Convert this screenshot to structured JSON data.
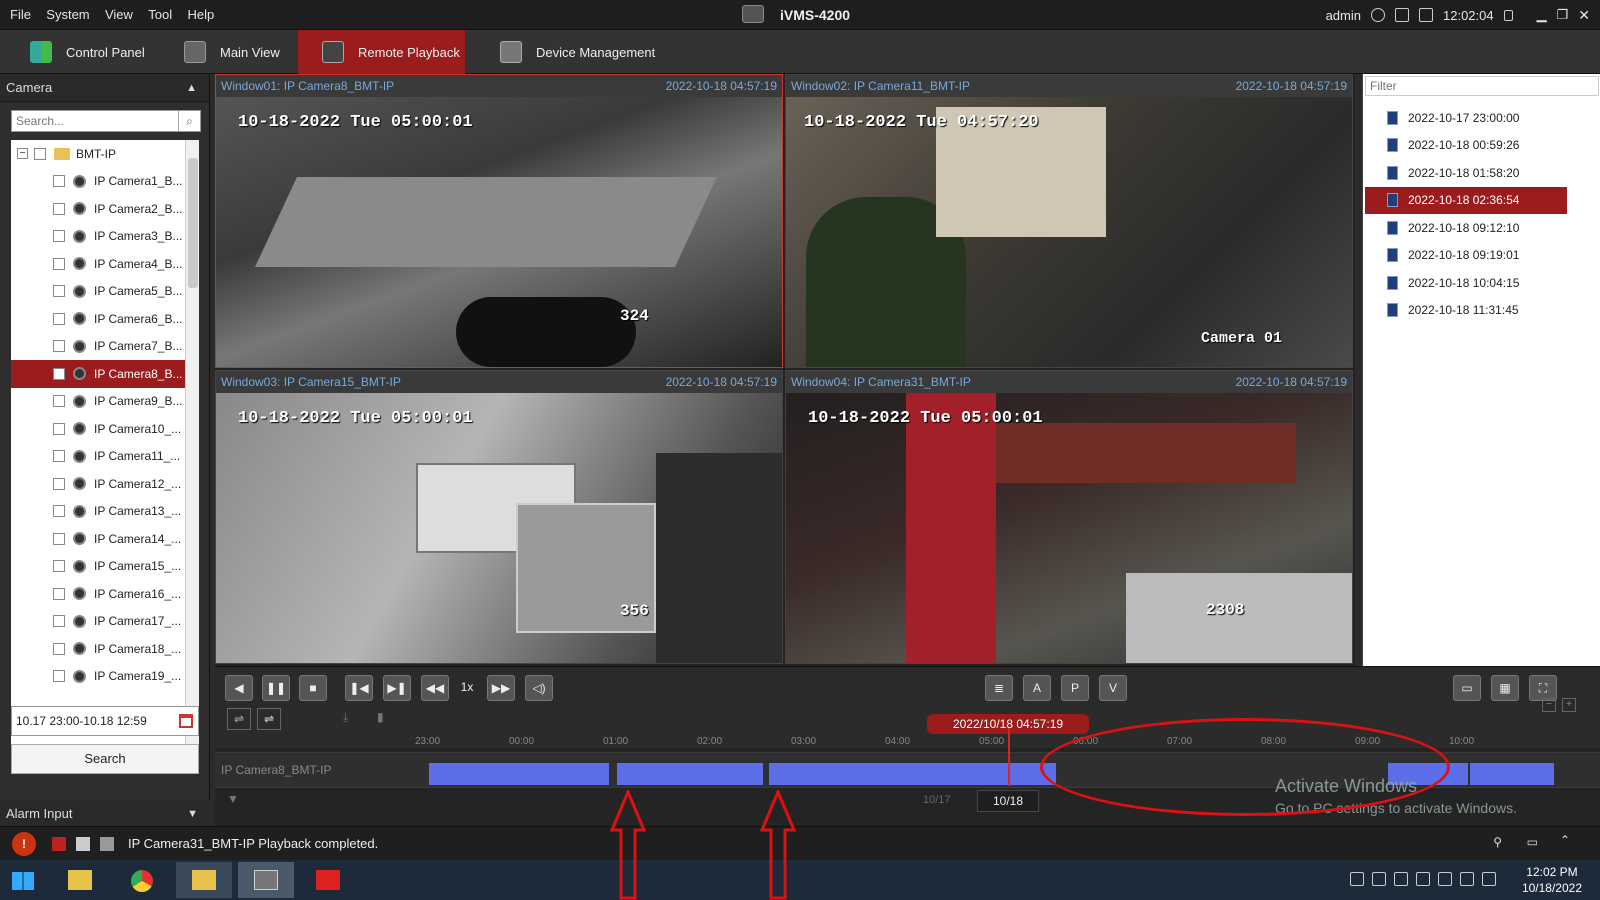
{
  "menubar": {
    "items": [
      "File",
      "System",
      "View",
      "Tool",
      "Help"
    ],
    "title": "iVMS-4200",
    "user": "admin",
    "clock": "12:02:04"
  },
  "tabs": [
    {
      "label": "Control Panel"
    },
    {
      "label": "Main View"
    },
    {
      "label": "Remote Playback"
    },
    {
      "label": "Device Management"
    }
  ],
  "left": {
    "camera_header": "Camera",
    "search_placeholder": "Search...",
    "root": "BMT-IP",
    "cameras": [
      "IP Camera1_B...",
      "IP Camera2_B...",
      "IP Camera3_B...",
      "IP Camera4_B...",
      "IP Camera5_B...",
      "IP Camera6_B...",
      "IP Camera7_B...",
      "IP Camera8_B...",
      "IP Camera9_B...",
      "IP Camera10_...",
      "IP Camera11_...",
      "IP Camera12_...",
      "IP Camera13_...",
      "IP Camera14_...",
      "IP Camera15_...",
      "IP Camera16_...",
      "IP Camera17_...",
      "IP Camera18_...",
      "IP Camera19_..."
    ],
    "date_range": "10.17 23:00-10.18 12:59",
    "search_button": "Search",
    "alarm_header": "Alarm Input"
  },
  "windows": [
    {
      "title": "Window01:  IP Camera8_BMT-IP",
      "ts": "2022-10-18 04:57:19",
      "osd": "10-18-2022 Tue 05:00:01",
      "num": "324"
    },
    {
      "title": "Window02:  IP Camera11_BMT-IP",
      "ts": "2022-10-18 04:57:19",
      "osd": "10-18-2022 Tue 04:57:20",
      "num": "Camera 01"
    },
    {
      "title": "Window03:  IP Camera15_BMT-IP",
      "ts": "2022-10-18 04:57:19",
      "osd": "10-18-2022 Tue 05:00:01",
      "num": "356"
    },
    {
      "title": "Window04:  IP Camera31_BMT-IP",
      "ts": "2022-10-18 04:57:19",
      "osd": "10-18-2022 Tue 05:00:01",
      "num": "2308"
    }
  ],
  "right": {
    "filter_placeholder": "Filter",
    "files": [
      "2022-10-17 23:00:00",
      "2022-10-18 00:59:26",
      "2022-10-18 01:58:20",
      "2022-10-18 02:36:54",
      "2022-10-18 09:12:10",
      "2022-10-18 09:19:01",
      "2022-10-18 10:04:15",
      "2022-10-18 11:31:45"
    ]
  },
  "controls": {
    "speed": "1x"
  },
  "timeline": {
    "current": "2022/10/18 04:57:19",
    "ticks": [
      "23:00",
      "00:00",
      "01:00",
      "02:00",
      "03:00",
      "04:00",
      "05:00",
      "06:00",
      "07:00",
      "08:00",
      "09:00",
      "10:00"
    ],
    "track_label": "IP Camera8_BMT-IP",
    "day_prev": "10/17",
    "day_cur": "10/18"
  },
  "status": {
    "message": "IP Camera31_BMT-IP Playback completed."
  },
  "watermark": {
    "line1": "Activate Windows",
    "line2": "Go to PC settings to activate Windows."
  },
  "taskbar": {
    "time": "12:02 PM",
    "date": "10/18/2022"
  },
  "colors": {
    "accent": "#9b1c1c",
    "segment": "#5d6fe8",
    "annotation": "#dd1111"
  }
}
